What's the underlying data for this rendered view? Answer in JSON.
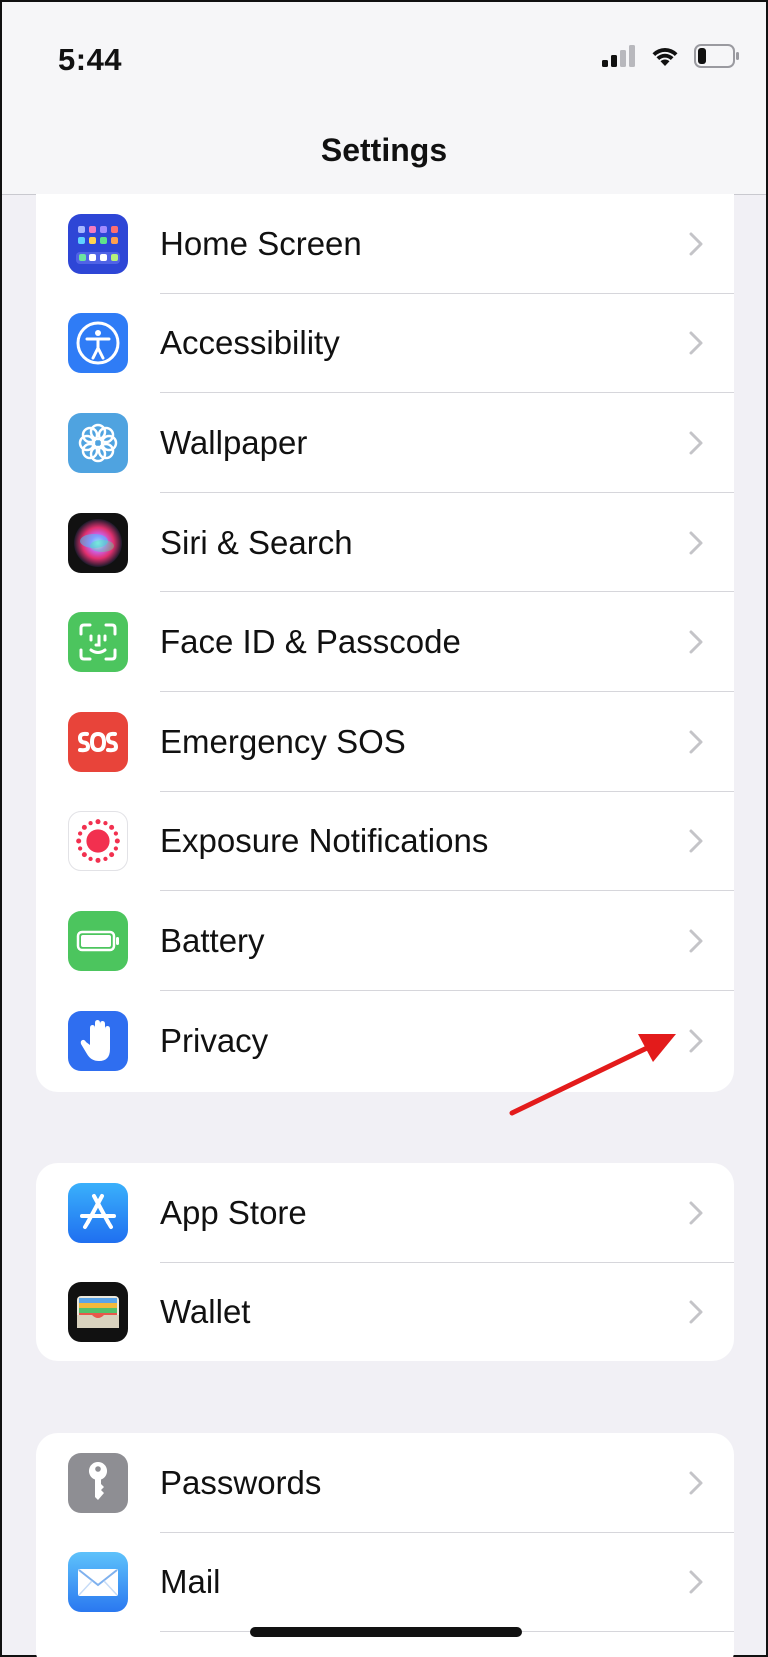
{
  "status_bar": {
    "time": "5:44"
  },
  "nav": {
    "title": "Settings"
  },
  "groups": [
    {
      "rows": [
        {
          "label": "Home Screen",
          "icon": "home-screen-icon",
          "color": "#2e46d6"
        },
        {
          "label": "Accessibility",
          "icon": "accessibility-icon",
          "color": "#2f7cf6"
        },
        {
          "label": "Wallpaper",
          "icon": "wallpaper-icon",
          "color": "#4fa3e0"
        },
        {
          "label": "Siri & Search",
          "icon": "siri-icon",
          "color": "#111111"
        },
        {
          "label": "Face ID & Passcode",
          "icon": "face-id-icon",
          "color": "#4cc55e"
        },
        {
          "label": "Emergency SOS",
          "icon": "sos-icon",
          "color": "#e8443a"
        },
        {
          "label": "Exposure Notifications",
          "icon": "exposure-icon",
          "color": "#ffffff"
        },
        {
          "label": "Battery",
          "icon": "battery-icon",
          "color": "#4cc55e"
        },
        {
          "label": "Privacy",
          "icon": "privacy-hand-icon",
          "color": "#2f6ef0"
        }
      ]
    },
    {
      "rows": [
        {
          "label": "App Store",
          "icon": "app-store-icon",
          "color": "#2a8cf5"
        },
        {
          "label": "Wallet",
          "icon": "wallet-icon",
          "color": "#111111"
        }
      ]
    },
    {
      "rows": [
        {
          "label": "Passwords",
          "icon": "key-icon",
          "color": "#8e8e93"
        },
        {
          "label": "Mail",
          "icon": "mail-icon",
          "color": "#3d8ff2"
        }
      ]
    }
  ],
  "annotation": {
    "arrow_color": "#e31b1b"
  }
}
